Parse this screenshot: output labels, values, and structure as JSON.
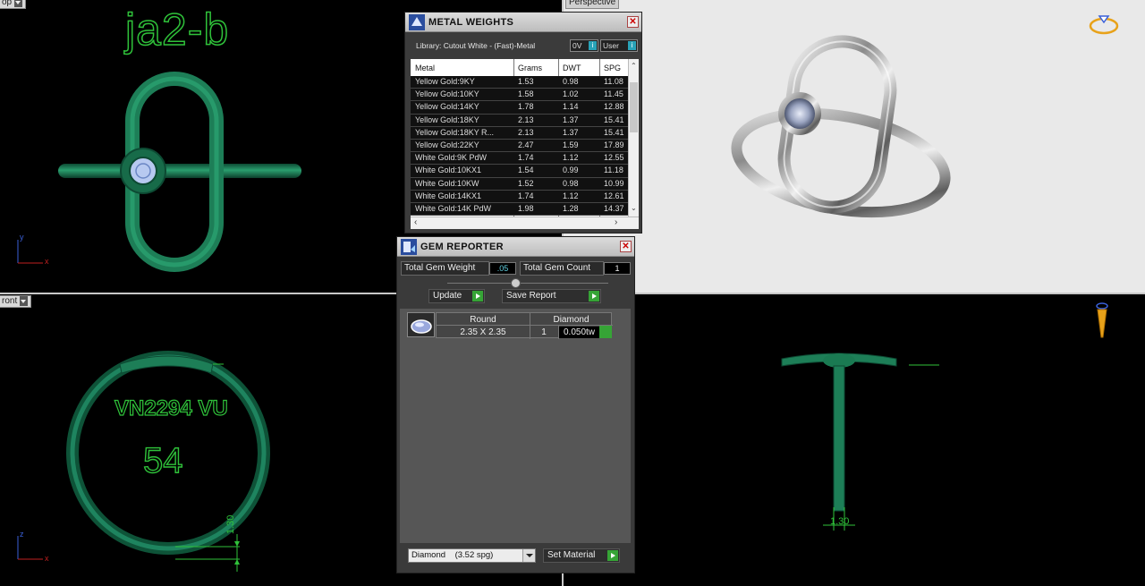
{
  "viewports": {
    "top_label": "op",
    "perspective_label": "Perspective",
    "front_label": "ront",
    "top_engraving": "ja2-b",
    "front_engraving_1": "VN2294 VU",
    "front_engraving_2": "54",
    "top_axis_y": "y",
    "top_axis_x": "x",
    "front_axis_z": "z",
    "front_axis_x": "x",
    "front_dim": "1.30",
    "right_dim": "1.30"
  },
  "metal_weights": {
    "title": "METAL WEIGHTS",
    "library": "Library: Cutout White - (Fast)-Metal",
    "toggle_1": "0V",
    "toggle_2": "User",
    "columns": [
      "Metal",
      "Grams",
      "DWT",
      "SPG"
    ],
    "rows": [
      [
        "Yellow Gold:9KY",
        "1.53",
        "0.98",
        "11.08"
      ],
      [
        "Yellow Gold:10KY",
        "1.58",
        "1.02",
        "11.45"
      ],
      [
        "Yellow Gold:14KY",
        "1.78",
        "1.14",
        "12.88"
      ],
      [
        "Yellow Gold:18KY",
        "2.13",
        "1.37",
        "15.41"
      ],
      [
        "Yellow Gold:18KY R...",
        "2.13",
        "1.37",
        "15.41"
      ],
      [
        "Yellow Gold:22KY",
        "2.47",
        "1.59",
        "17.89"
      ],
      [
        "White Gold:9K PdW",
        "1.74",
        "1.12",
        "12.55"
      ],
      [
        "White Gold:10KX1",
        "1.54",
        "0.99",
        "11.18"
      ],
      [
        "White Gold:10KW",
        "1.52",
        "0.98",
        "10.99"
      ],
      [
        "White Gold:14KX1",
        "1.74",
        "1.12",
        "12.61"
      ],
      [
        "White Gold:14K PdW",
        "1.98",
        "1.28",
        "14.37"
      ]
    ]
  },
  "gem_reporter": {
    "title": "GEM REPORTER",
    "total_weight_label": "Total Gem Weight",
    "total_weight_value": ".05",
    "total_count_label": "Total Gem Count",
    "total_count_value": "1",
    "update_label": "Update",
    "save_label": "Save Report",
    "gem_shape": "Round",
    "gem_type": "Diamond",
    "gem_size": "2.35 X 2.35",
    "gem_qty": "1",
    "gem_tw": "0.050tw",
    "material_select": "Diamond    (3.52 spg)",
    "set_material_label": "Set Material"
  },
  "colors": {
    "wire_green": "#2fc23a",
    "ring_green": "#1f8a5e",
    "accent_green": "#36a436",
    "accent_cyan": "#29a3b8"
  }
}
